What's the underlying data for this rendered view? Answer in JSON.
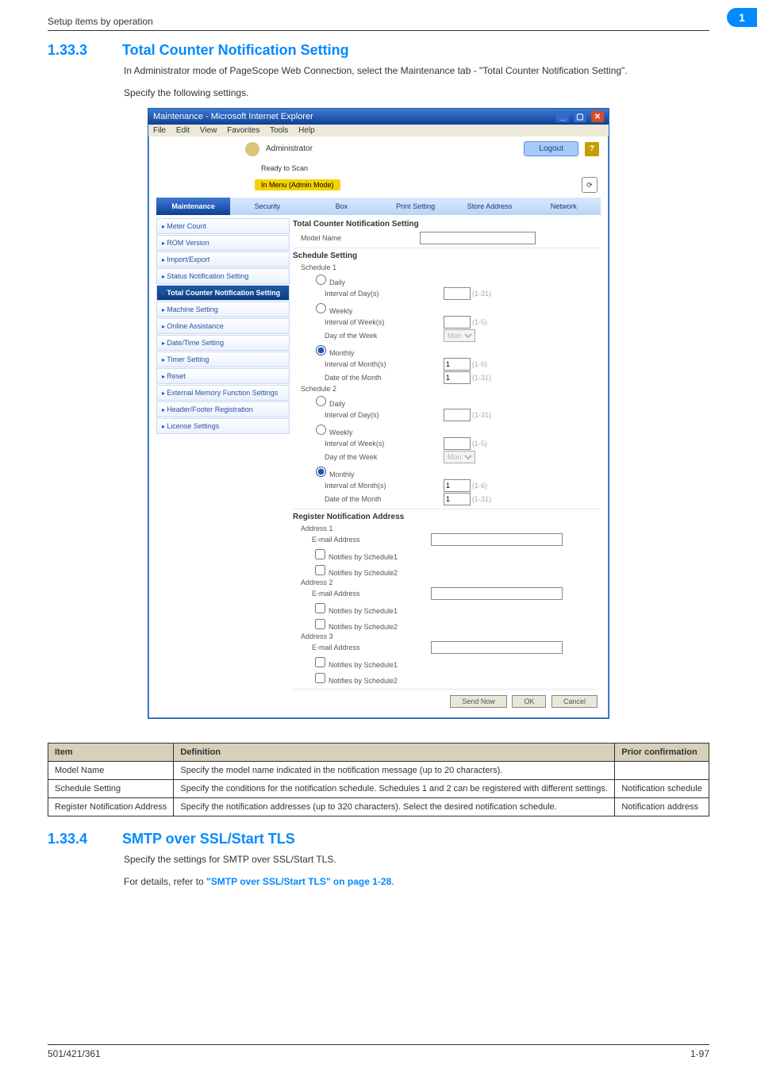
{
  "header": {
    "left": "Setup items by operation",
    "badge": "1"
  },
  "section1": {
    "num": "1.33.3",
    "title": "Total Counter Notification Setting",
    "para1": "In Administrator mode of PageScope Web Connection, select the Maintenance tab - \"Total Counter Notification Setting\".",
    "para2": "Specify the following settings."
  },
  "ie": {
    "title": "Maintenance - Microsoft Internet Explorer",
    "menubar": {
      "file": "File",
      "edit": "Edit",
      "view": "View",
      "favorites": "Favorites",
      "tools": "Tools",
      "help": "Help"
    },
    "adminbar": {
      "user": "Administrator",
      "logout": "Logout",
      "help": "?"
    },
    "status": {
      "ready": "Ready to Scan",
      "mode": "In Menu (Admin Mode)"
    },
    "tabs": [
      "Maintenance",
      "Security",
      "Box",
      "Print Setting",
      "Store Address",
      "Network"
    ],
    "sidemenu": [
      "Meter Count",
      "ROM Version",
      "Import/Export",
      "Status Notification Setting",
      "Total Counter Notification Setting",
      "Machine Setting",
      "Online Assistance",
      "Date/Time Setting",
      "Timer Setting",
      "Reset",
      "External Memory Function Settings",
      "Header/Footer Registration",
      "License Settings"
    ],
    "content": {
      "heading": "Total Counter Notification Setting",
      "model_label": "Model Name",
      "sched_heading": "Schedule Setting",
      "sched1": "Schedule 1",
      "sched2": "Schedule 2",
      "daily": "Daily",
      "weekly": "Weekly",
      "monthly": "Monthly",
      "int_day": "Interval of Day(s)",
      "int_week": "Interval of Week(s)",
      "dow": "Day of the Week",
      "int_month": "Interval of Month(s)",
      "dom": "Date of the Month",
      "r131": "(1-31)",
      "r15": "(1-5)",
      "r16": "(1-6)",
      "mon": "Mon",
      "val1": "1",
      "reg_heading": "Register Notification Address",
      "addr1": "Address 1",
      "addr2": "Address 2",
      "addr3": "Address 3",
      "email": "E-mail Address",
      "nb1": "Notifies by Schedule1",
      "nb2": "Notifies by Schedule2",
      "send": "Send Now",
      "ok": "OK",
      "cancel": "Cancel"
    }
  },
  "deftable": {
    "headers": [
      "Item",
      "Definition",
      "Prior confirmation"
    ],
    "rows": [
      [
        "Model Name",
        "Specify the model name indicated in the notification message (up to 20 characters).",
        ""
      ],
      [
        "Schedule Setting",
        "Specify the conditions for the notification schedule. Schedules 1 and 2 can be registered with different settings.",
        "Notification schedule"
      ],
      [
        "Register Notification Address",
        "Specify the notification addresses (up to 320 characters). Select the desired notification schedule.",
        "Notification address"
      ]
    ]
  },
  "section2": {
    "num": "1.33.4",
    "title": "SMTP over SSL/Start TLS",
    "para1": "Specify the settings for SMTP over SSL/Start TLS.",
    "para2_prefix": "For details, refer to ",
    "para2_link": "\"SMTP over SSL/Start TLS\" on page 1-28",
    "para2_suffix": "."
  },
  "footer": {
    "left": "501/421/361",
    "right": "1-97"
  }
}
